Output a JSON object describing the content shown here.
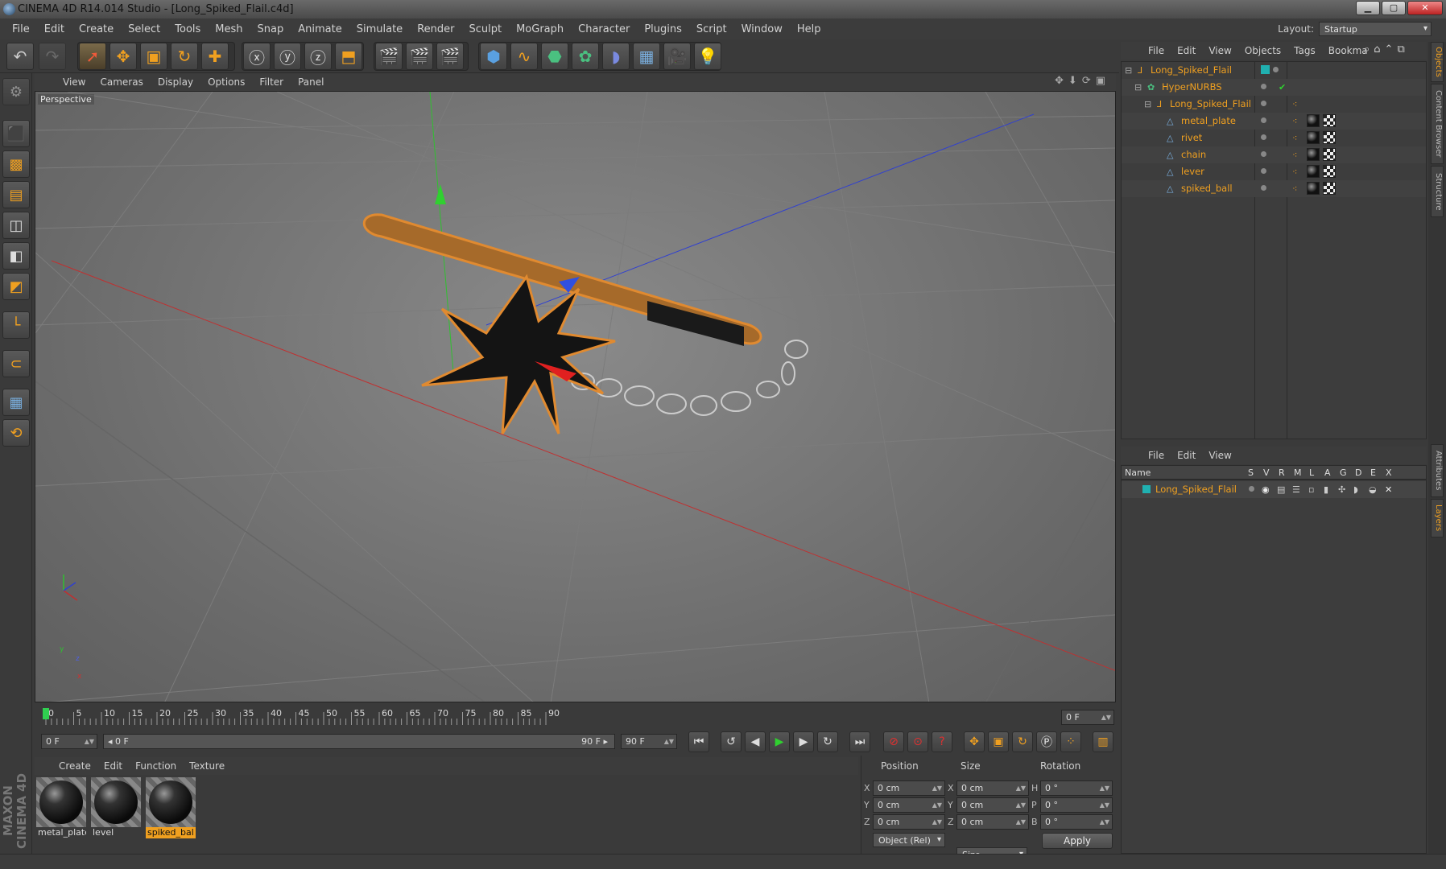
{
  "window": {
    "title": "CINEMA 4D R14.014 Studio - [Long_Spiked_Flail.c4d]",
    "minimize": "▁",
    "maximize": "▢",
    "close": "✕"
  },
  "menubar": [
    "File",
    "Edit",
    "Create",
    "Select",
    "Tools",
    "Mesh",
    "Snap",
    "Animate",
    "Simulate",
    "Render",
    "Sculpt",
    "MoGraph",
    "Character",
    "Plugins",
    "Script",
    "Window",
    "Help"
  ],
  "layout": {
    "label": "Layout:",
    "value": "Startup"
  },
  "viewport": {
    "menu": [
      "View",
      "Cameras",
      "Display",
      "Options",
      "Filter",
      "Panel"
    ],
    "label": "Perspective",
    "axis_labels": {
      "x": "x",
      "y": "y",
      "z": "z"
    }
  },
  "timeline": {
    "ticks": [
      "0",
      "5",
      "10",
      "15",
      "20",
      "25",
      "30",
      "35",
      "40",
      "45",
      "50",
      "55",
      "60",
      "65",
      "70",
      "75",
      "80",
      "85",
      "90"
    ],
    "current_frame": "0 F",
    "start_field": "0 F",
    "range_start": "◂ 0 F",
    "range_end": "90 F ▸",
    "end_field": "90 F"
  },
  "materials": {
    "menu": [
      "Create",
      "Edit",
      "Function",
      "Texture"
    ],
    "items": [
      {
        "name": "metal_plate",
        "selected": false
      },
      {
        "name": "level",
        "selected": false
      },
      {
        "name": "spiked_bal",
        "selected": true
      }
    ]
  },
  "branding": "MAXON CINEMA 4D",
  "coordinates": {
    "headers": [
      "Position",
      "Size",
      "Rotation"
    ],
    "rows": [
      {
        "pos_axis": "X",
        "pos": "0 cm",
        "size_axis": "X",
        "size": "0 cm",
        "rot_axis": "H",
        "rot": "0 °"
      },
      {
        "pos_axis": "Y",
        "pos": "0 cm",
        "size_axis": "Y",
        "size": "0 cm",
        "rot_axis": "P",
        "rot": "0 °"
      },
      {
        "pos_axis": "Z",
        "pos": "0 cm",
        "size_axis": "Z",
        "size": "0 cm",
        "rot_axis": "B",
        "rot": "0 °"
      }
    ],
    "mode": "Object (Rel)",
    "size_mode": "Size",
    "apply": "Apply"
  },
  "object_manager": {
    "menu": [
      "File",
      "Edit",
      "View",
      "Objects",
      "Tags",
      "Bookma"
    ],
    "objects": [
      {
        "name": "Long_Spiked_Flail",
        "icon": "null-icon"
      },
      {
        "name": "HyperNURBS",
        "icon": "hypernurbs-icon"
      },
      {
        "name": "Long_Spiked_Flail",
        "icon": "null-icon"
      },
      {
        "name": "metal_plate",
        "icon": "polygon-icon"
      },
      {
        "name": "rivet",
        "icon": "polygon-icon"
      },
      {
        "name": "chain",
        "icon": "polygon-icon"
      },
      {
        "name": "lever",
        "icon": "polygon-icon"
      },
      {
        "name": "spiked_ball",
        "icon": "polygon-icon"
      }
    ]
  },
  "layers": {
    "menu": [
      "File",
      "Edit",
      "View"
    ],
    "columns": {
      "name": "Name",
      "flags": [
        "S",
        "V",
        "R",
        "M",
        "L",
        "A",
        "G",
        "D",
        "E",
        "X"
      ]
    },
    "rows": [
      {
        "name": "Long_Spiked_Flail",
        "color": "#20b0b0"
      }
    ]
  },
  "right_tabs": [
    "Objects",
    "Content Browser",
    "Structure",
    "Attributes",
    "Layers"
  ],
  "colors": {
    "accent": "#f0a020",
    "x_axis": "#d03030",
    "y_axis": "#30c030",
    "z_axis": "#3040d0"
  }
}
